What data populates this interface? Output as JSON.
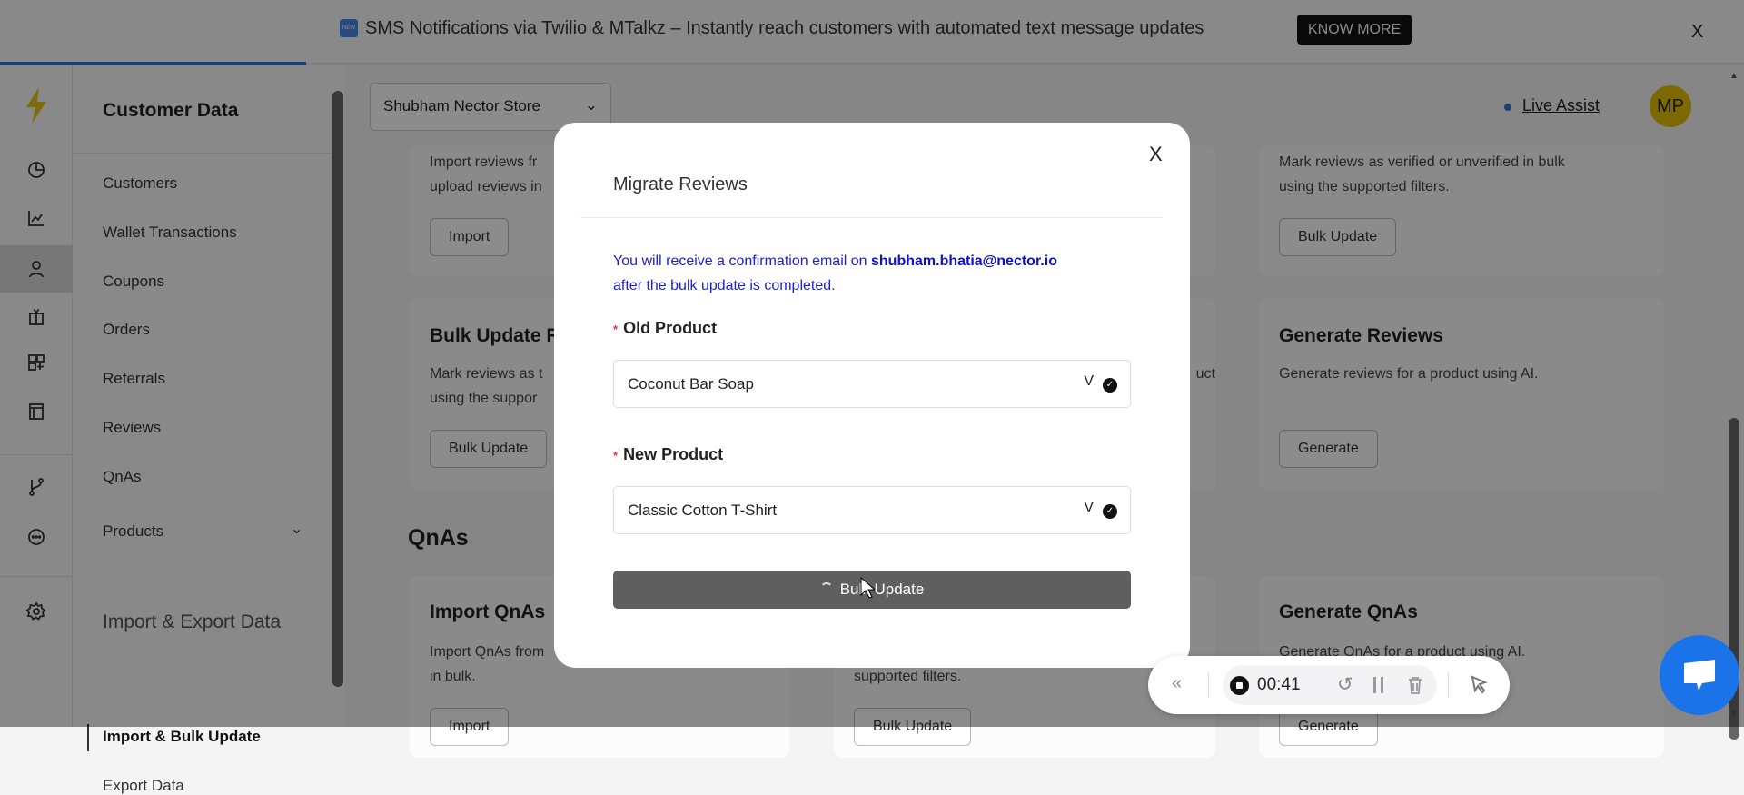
{
  "banner": {
    "badge": "NEW",
    "text": "SMS Notifications via Twilio & MTalkz – Instantly reach customers with automated text message updates",
    "cta": "KNOW MORE",
    "close": "X"
  },
  "sidebar": {
    "heading": "Customer Data",
    "items": [
      "Customers",
      "Wallet Transactions",
      "Coupons",
      "Orders",
      "Referrals",
      "Reviews",
      "QnAs",
      "Products"
    ],
    "section": "Import & Export Data",
    "sub_items": [
      "Import & Bulk Update",
      "Export Data"
    ]
  },
  "header": {
    "store": "Shubham Nector Store",
    "live_assist": "Live Assist",
    "avatar": "MP"
  },
  "cards": {
    "r1c1": {
      "desc1": "Import reviews fr",
      "desc2": "upload reviews in",
      "button": "Import"
    },
    "r1c3": {
      "desc1": "Mark reviews as verified or unverified in bulk",
      "desc2": "using the supported filters.",
      "button": "Bulk Update"
    },
    "r2c1": {
      "title": "Bulk Update R",
      "desc1": "Mark reviews as t",
      "desc2": "using the suppor",
      "button": "Bulk Update"
    },
    "r2c2": {
      "desc1": "uct"
    },
    "r2c3": {
      "title": "Generate Reviews",
      "desc1": "Generate reviews for a product using AI.",
      "button": "Generate"
    },
    "qna_heading": "QnAs",
    "r3c1": {
      "title": "Import QnAs",
      "desc1": "Import QnAs from",
      "desc2": "in bulk.",
      "button": "Import"
    },
    "r3c2": {
      "desc2": "supported filters.",
      "button": "Bulk Update"
    },
    "r3c3": {
      "title": "Generate QnAs",
      "desc1": "Generate QnAs for a product using AI.",
      "button": "Generate"
    }
  },
  "modal": {
    "title": "Migrate Reviews",
    "close": "X",
    "info_prefix": "You will receive a confirmation email on ",
    "email": "shubham.bhatia@nector.io",
    "info_suffix": "after the bulk update is completed.",
    "old_label": "Old Product",
    "old_value": "Coconut Bar Soap",
    "new_label": "New Product",
    "new_value": "Classic Cotton T-Shirt",
    "submit": "Bulk Update",
    "required": "*"
  },
  "recorder": {
    "time": "00:41"
  },
  "colors": {
    "accent": "#2a78d6",
    "avatar": "#e2bf00",
    "link": "#2020d0",
    "chat": "#1a73e8"
  }
}
